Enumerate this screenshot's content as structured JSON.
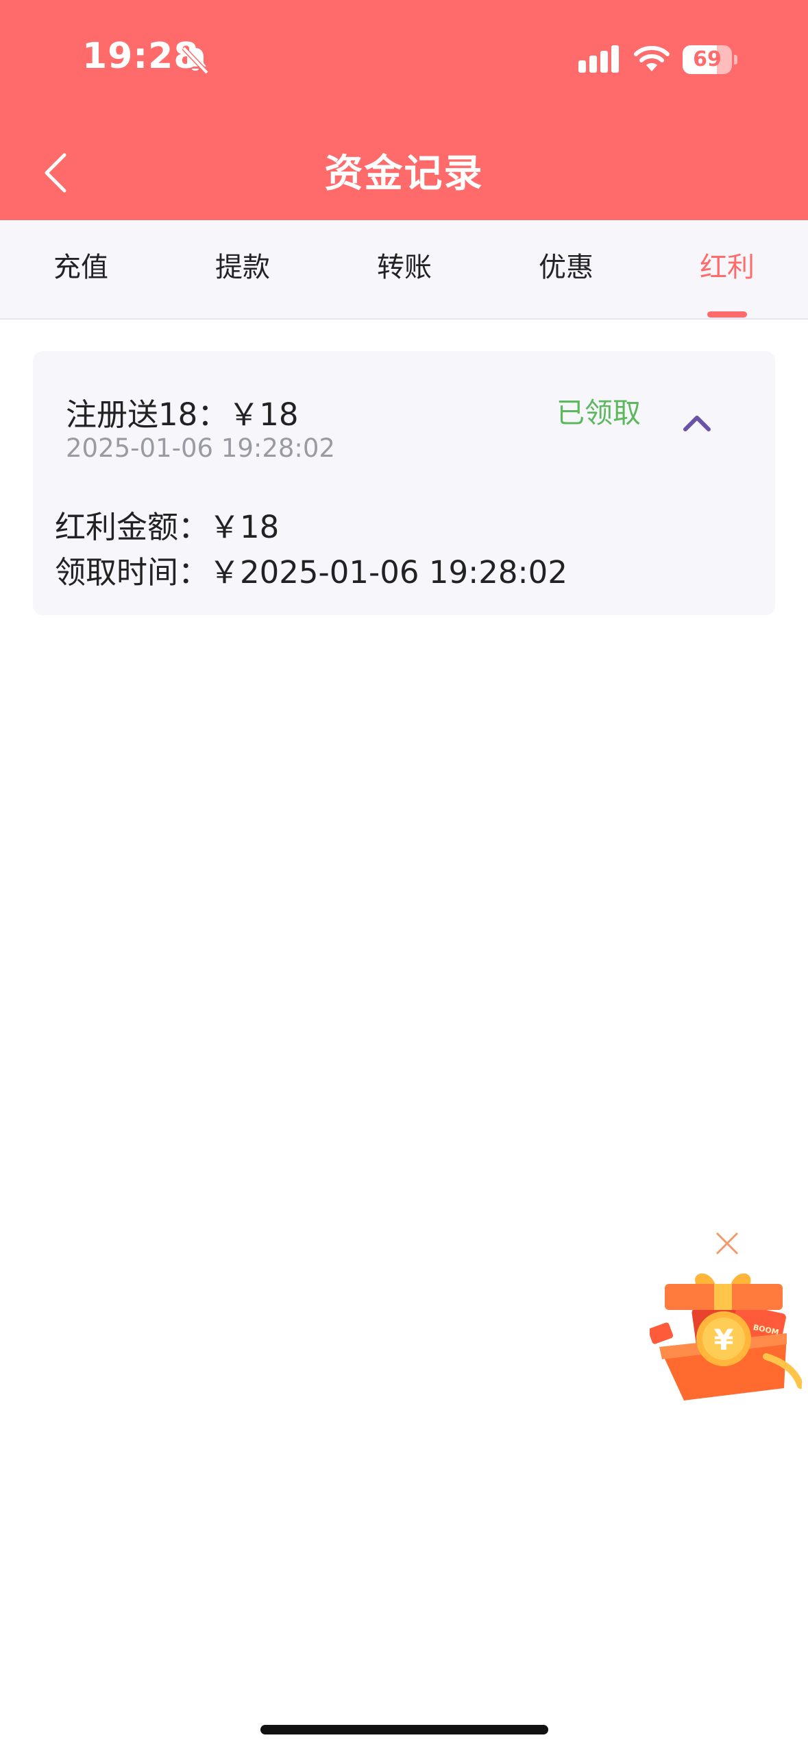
{
  "status_bar": {
    "time": "19:28",
    "battery": "69",
    "battery_level": 0.69,
    "icons": [
      "bell-slash-icon",
      "cellular-signal-icon",
      "wifi-icon",
      "battery-icon"
    ]
  },
  "header": {
    "title": "资金记录",
    "back_icon": "chevron-left-icon"
  },
  "tabs": [
    {
      "label": "充值",
      "active": false
    },
    {
      "label": "提款",
      "active": false
    },
    {
      "label": "转账",
      "active": false
    },
    {
      "label": "优惠",
      "active": false
    },
    {
      "label": "红利",
      "active": true
    }
  ],
  "records": [
    {
      "title": "注册送18：￥18",
      "date": "2025-01-06 19:28:02",
      "status": "已领取",
      "expanded": true,
      "details": [
        {
          "label": "红利金额：",
          "value": "￥18"
        },
        {
          "label": "领取时间：",
          "value": "￥2025-01-06 19:28:02"
        }
      ]
    }
  ],
  "floating_promo": {
    "close_icon": "close-icon",
    "image": "gift-box-icon",
    "box_text": "BOOM"
  },
  "colors": {
    "brand": "#ff6b6b",
    "status_claimed": "#5cb85c",
    "chevron": "#6a52a8",
    "tabs_bg": "#f6f6fb"
  }
}
